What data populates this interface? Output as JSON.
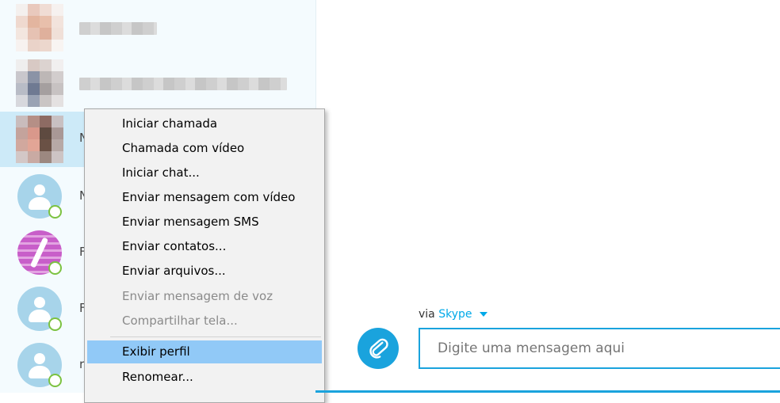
{
  "contacts": {
    "truncated_initials": [
      "N",
      "N",
      "F",
      "F",
      "r"
    ]
  },
  "context_menu": {
    "items": [
      {
        "label": "Iniciar chamada",
        "enabled": true
      },
      {
        "label": "Chamada com vídeo",
        "enabled": true
      },
      {
        "label": "Iniciar chat...",
        "enabled": true
      },
      {
        "label": "Enviar mensagem com vídeo",
        "enabled": true
      },
      {
        "label": "Enviar mensagem SMS",
        "enabled": true
      },
      {
        "label": "Enviar contatos...",
        "enabled": true
      },
      {
        "label": "Enviar arquivos...",
        "enabled": true
      },
      {
        "label": "Enviar mensagem de voz",
        "enabled": false
      },
      {
        "label": "Compartilhar tela...",
        "enabled": false
      },
      {
        "label": "Exibir perfil",
        "enabled": true,
        "highlighted": true
      },
      {
        "label": "Renomear...",
        "enabled": true
      }
    ]
  },
  "composer": {
    "via_prefix": "via",
    "via_service": "Skype",
    "placeholder": "Digite uma mensagem aqui",
    "attach_icon": "paperclip-icon"
  },
  "colors": {
    "accent": "#1aa3dd",
    "menu_highlight": "#91c9f7",
    "presence_online": "#7cc241",
    "selected_row": "#cdeaf8"
  }
}
